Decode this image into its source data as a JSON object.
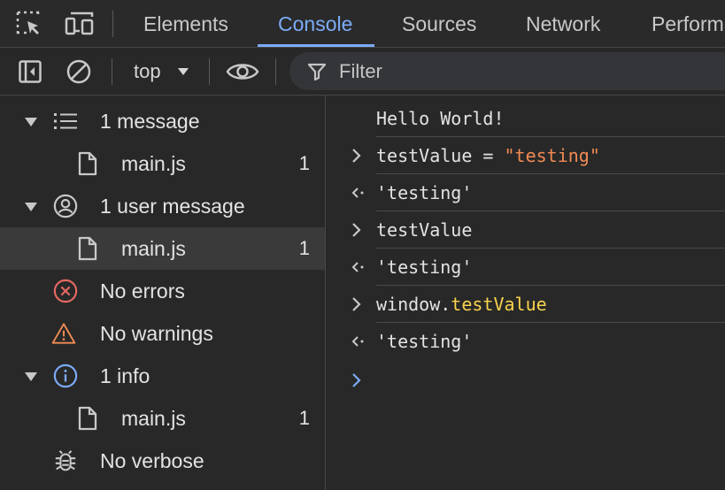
{
  "tabs": [
    {
      "label": "Elements"
    },
    {
      "label": "Console"
    },
    {
      "label": "Sources"
    },
    {
      "label": "Network"
    },
    {
      "label": "Perform"
    }
  ],
  "active_tab": "Console",
  "toolbar": {
    "context": "top",
    "filter_placeholder": "Filter"
  },
  "sidebar": {
    "items": [
      {
        "label": "1 message",
        "count": ""
      },
      {
        "label": "main.js",
        "count": "1"
      },
      {
        "label": "1 user message",
        "count": ""
      },
      {
        "label": "main.js",
        "count": "1"
      },
      {
        "label": "No errors",
        "count": ""
      },
      {
        "label": "No warnings",
        "count": ""
      },
      {
        "label": "1 info",
        "count": ""
      },
      {
        "label": "main.js",
        "count": "1"
      },
      {
        "label": "No verbose",
        "count": ""
      }
    ]
  },
  "console": {
    "log_hello": "Hello World!",
    "in1_var": "testValue = ",
    "in1_str": "\"testing\"",
    "out1": "'testing'",
    "in2": "testValue",
    "out2": "'testing'",
    "in3_obj": "window.",
    "in3_prop": "testValue",
    "out3": "'testing'"
  },
  "colors": {
    "accent": "#7cacf8",
    "error": "#e46962",
    "warning": "#f28b54",
    "info": "#7cacf8",
    "string_result": "#5cc8f5",
    "string_input": "#f28b54",
    "property": "#f7d34d"
  }
}
